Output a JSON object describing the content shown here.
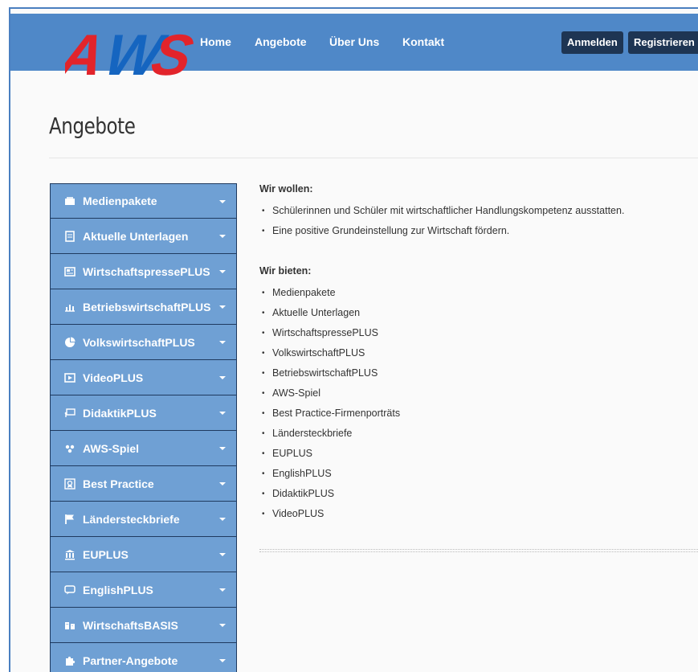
{
  "brand": {
    "logo_text": "AWS"
  },
  "nav": {
    "links": [
      "Home",
      "Angebote",
      "Über Uns",
      "Kontakt"
    ],
    "login_label": "Anmelden",
    "register_label": "Registrieren"
  },
  "page": {
    "title": "Angebote"
  },
  "sidebar": {
    "items": [
      {
        "label": "Medienpakete",
        "icon": "media-package-icon"
      },
      {
        "label": "Aktuelle Unterlagen",
        "icon": "document-icon"
      },
      {
        "label": "WirtschaftspressePLUS",
        "icon": "newspaper-icon"
      },
      {
        "label": "BetriebswirtschaftPLUS",
        "icon": "bar-chart-icon"
      },
      {
        "label": "VolkswirtschaftPLUS",
        "icon": "pie-chart-icon"
      },
      {
        "label": "VideoPLUS",
        "icon": "video-icon"
      },
      {
        "label": "DidaktikPLUS",
        "icon": "presentation-icon"
      },
      {
        "label": "AWS-Spiel",
        "icon": "game-icon"
      },
      {
        "label": "Best Practice",
        "icon": "award-icon"
      },
      {
        "label": "Ländersteckbriefe",
        "icon": "flag-icon"
      },
      {
        "label": "EUPLUS",
        "icon": "institution-icon"
      },
      {
        "label": "EnglishPLUS",
        "icon": "chat-icon"
      },
      {
        "label": "WirtschaftsBASIS",
        "icon": "building-icon"
      },
      {
        "label": "Partner-Angebote",
        "icon": "puzzle-icon"
      }
    ]
  },
  "content": {
    "goals_heading": "Wir wollen:",
    "goals": [
      "Schülerinnen und Schüler mit wirtschaftlicher Handlungskompetenz ausstatten.",
      "Eine positive Grundeinstellung zur Wirtschaft fördern."
    ],
    "offers_heading": "Wir bieten:",
    "offers": [
      "Medienpakete",
      "Aktuelle Unterlagen",
      "WirtschaftspressePLUS",
      "VolkswirtschaftPLUS",
      "BetriebswirtschaftPLUS",
      "AWS-Spiel",
      "Best Practice-Firmenporträts",
      "Ländersteckbriefe",
      "EUPLUS",
      "EnglishPLUS",
      "DidaktikPLUS",
      "VideoPLUS"
    ]
  },
  "colors": {
    "navbar": "#4f88c8",
    "sidebar_item": "#6fa0d4",
    "sidebar_border": "#1f3a5f",
    "logo_red": "#e2242b",
    "logo_blue": "#1565c0",
    "nav_button": "#1e3553"
  }
}
